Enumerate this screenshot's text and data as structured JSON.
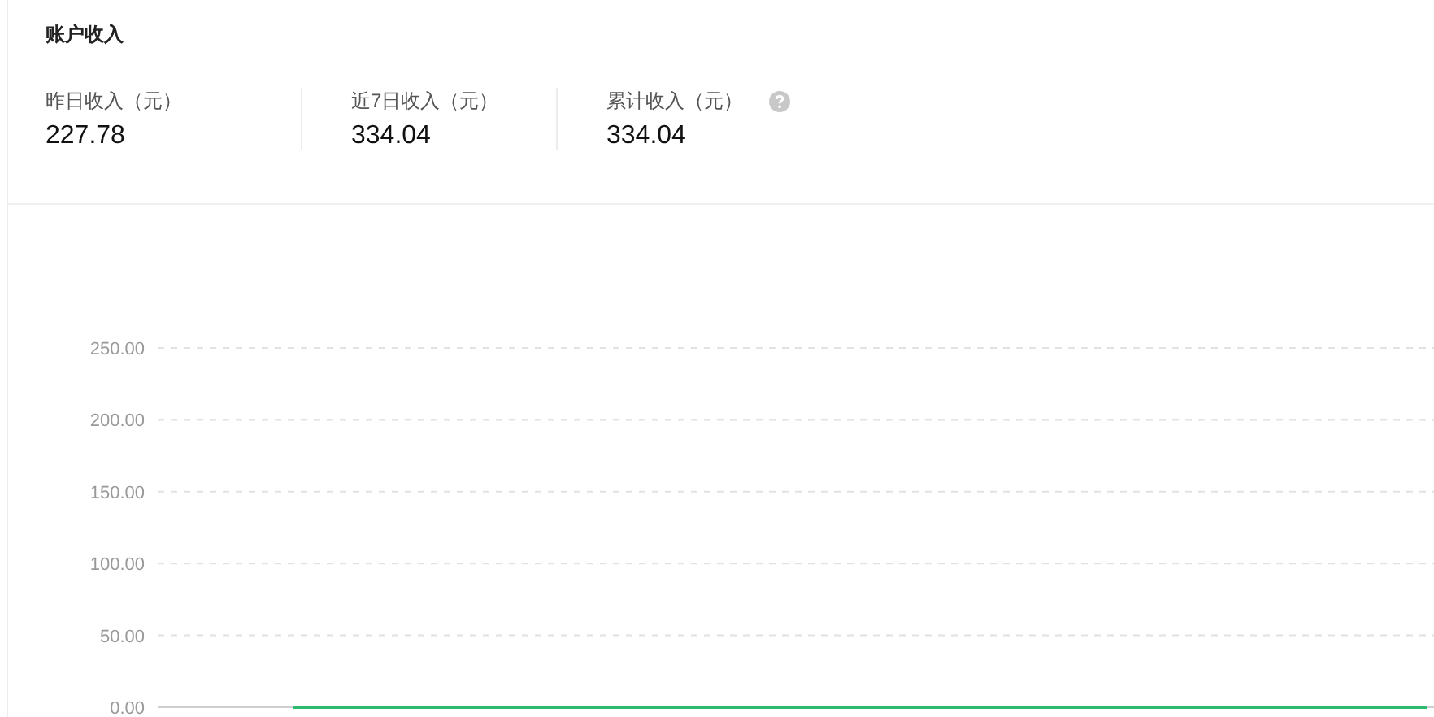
{
  "title": "账户收入",
  "stats": [
    {
      "label": "昨日收入（元）",
      "value": "227.78",
      "help": false
    },
    {
      "label": "近7日收入（元）",
      "value": "334.04",
      "help": false
    },
    {
      "label": "累计收入（元）",
      "value": "334.04",
      "help": true
    }
  ],
  "chart_data": {
    "type": "line",
    "grid": true,
    "ylim": [
      0,
      250
    ],
    "yticks": [
      {
        "value": 0,
        "label": "0.00"
      },
      {
        "value": 50,
        "label": "50.00"
      },
      {
        "value": 100,
        "label": "100.00"
      },
      {
        "value": 150,
        "label": "150.00"
      },
      {
        "value": 200,
        "label": "200.00"
      },
      {
        "value": 250,
        "label": "250.00"
      }
    ],
    "series": [
      {
        "color": "#2dbb6f",
        "values": [
          0,
          0,
          0
        ]
      }
    ]
  }
}
